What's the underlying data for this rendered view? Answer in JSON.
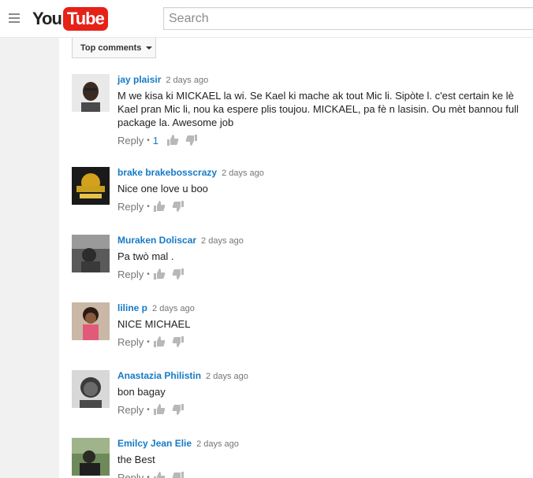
{
  "header": {
    "logo_you": "You",
    "logo_tube": "Tube",
    "search_placeholder": "Search"
  },
  "sort": {
    "label": "Top comments"
  },
  "comments": [
    {
      "author": "jay plaisir",
      "time": "2 days ago",
      "text": "M we kisa ki MICKAEL la wi. Se Kael ki mache ak tout Mic li. Sipòte l. c'est certain ke lè Kael pran Mic li, nou ka espere plis toujou. MICKAEL, pa fè n lasisin. Ou mèt bannou full package la. Awesome job",
      "reply": "Reply",
      "likes": "1"
    },
    {
      "author": "brake brakebosscrazy",
      "time": "2 days ago",
      "text": "Nice one love u boo",
      "reply": "Reply",
      "likes": ""
    },
    {
      "author": "Muraken Doliscar",
      "time": "2 days ago",
      "text": "Pa twò mal .",
      "reply": "Reply",
      "likes": ""
    },
    {
      "author": "liline p",
      "time": "2 days ago",
      "text": "NICE MICHAEL",
      "reply": "Reply",
      "likes": ""
    },
    {
      "author": "Anastazia Philistin",
      "time": "2 days ago",
      "text": "bon bagay",
      "reply": "Reply",
      "likes": ""
    },
    {
      "author": "Emilcy Jean Elie",
      "time": "2 days ago",
      "text": "the Best",
      "reply": "Reply",
      "likes": ""
    }
  ],
  "colors": {
    "author": "#167ac6",
    "brand_red": "#e62117"
  }
}
